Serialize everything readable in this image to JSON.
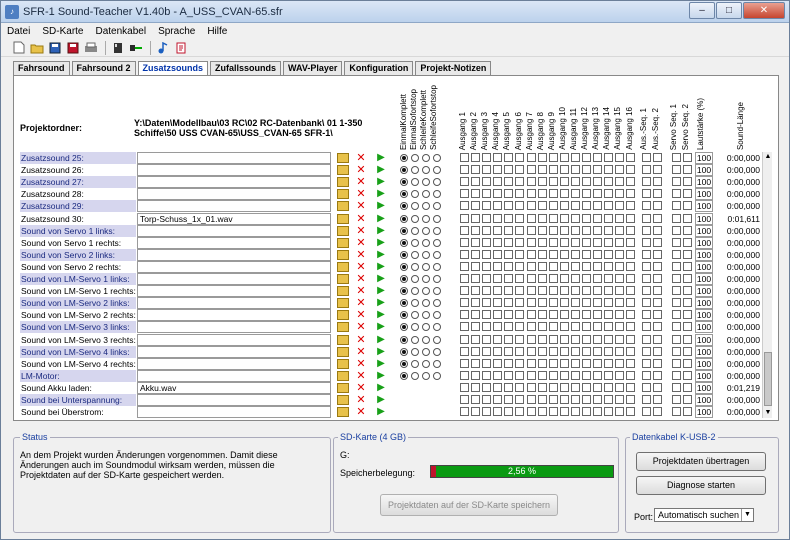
{
  "window": {
    "title": "SFR-1 Sound-Teacher V1.40b - A_USS_CVAN-65.sfr",
    "btn_min": "–",
    "btn_max": "□",
    "btn_close": "✕"
  },
  "menu": [
    "Datei",
    "SD-Karte",
    "Datenkabel",
    "Sprache",
    "Hilfe"
  ],
  "tabs": [
    "Fahrsound",
    "Fahrsound 2",
    "Zusatzsounds",
    "Zufallssounds",
    "WAV-Player",
    "Konfiguration",
    "Projekt-Notizen"
  ],
  "active_tab": 2,
  "project": {
    "label": "Projektordner:",
    "path_line1": "Y:\\Daten\\Modellbau\\03 RC\\02 RC-Datenbank\\ 01 1-350",
    "path_line2": "Schiffe\\50 USS CVAN-65\\USS_CVAN-65 SFR-1\\"
  },
  "col_headers": {
    "modes": [
      "EinmalKomplett",
      "EinmalSofortstop",
      "SchleifeKomplett",
      "SchleifeSofortstop"
    ],
    "outputs": [
      "Ausgang 1",
      "Ausgang 2",
      "Ausgang 3",
      "Ausgang 4",
      "Ausgang 5",
      "Ausgang 6",
      "Ausgang 7",
      "Ausgang 8",
      "Ausgang 9",
      "Ausgang 10",
      "Ausgang 11",
      "Ausgang 12",
      "Ausgang 13",
      "Ausgang 14",
      "Ausgang 15",
      "Ausgang 16"
    ],
    "aus_seq": [
      "Aus.-Seq. 1",
      "Aus.-Seq. 2"
    ],
    "servo_seq": [
      "Servo Seq. 1",
      "Servo Seq. 2"
    ],
    "volume": "Lautstärke (%)",
    "length": "Sound-Länge"
  },
  "rows": [
    {
      "label": "Zusatzsound 25:",
      "file": "",
      "volume": "100",
      "length": "0:00,000",
      "mode": true
    },
    {
      "label": "Zusatzsound 26:",
      "file": "",
      "volume": "100",
      "length": "0:00,000",
      "mode": true
    },
    {
      "label": "Zusatzsound 27:",
      "file": "",
      "volume": "100",
      "length": "0:00,000",
      "mode": true
    },
    {
      "label": "Zusatzsound 28:",
      "file": "",
      "volume": "100",
      "length": "0:00,000",
      "mode": true
    },
    {
      "label": "Zusatzsound 29:",
      "file": "",
      "volume": "100",
      "length": "0:00,000",
      "mode": true
    },
    {
      "label": "Zusatzsound 30:",
      "file": "Torp-Schuss_1x_01.wav",
      "volume": "100",
      "length": "0:01,611",
      "mode": true
    },
    {
      "label": "Sound von Servo 1 links:",
      "file": "",
      "volume": "100",
      "length": "0:00,000",
      "mode": true
    },
    {
      "label": "Sound von Servo 1 rechts:",
      "file": "",
      "volume": "100",
      "length": "0:00,000",
      "mode": true
    },
    {
      "label": "Sound von Servo 2 links:",
      "file": "",
      "volume": "100",
      "length": "0:00,000",
      "mode": true
    },
    {
      "label": "Sound von Servo 2 rechts:",
      "file": "",
      "volume": "100",
      "length": "0:00,000",
      "mode": true
    },
    {
      "label": "Sound von LM-Servo 1 links:",
      "file": "",
      "volume": "100",
      "length": "0:00,000",
      "mode": true
    },
    {
      "label": "Sound von LM-Servo 1 rechts:",
      "file": "",
      "volume": "100",
      "length": "0:00,000",
      "mode": true
    },
    {
      "label": "Sound von LM-Servo 2 links:",
      "file": "",
      "volume": "100",
      "length": "0:00,000",
      "mode": true
    },
    {
      "label": "Sound von LM-Servo 2 rechts:",
      "file": "",
      "volume": "100",
      "length": "0:00,000",
      "mode": true
    },
    {
      "label": "Sound von LM-Servo 3 links:",
      "file": "",
      "volume": "100",
      "length": "0:00,000",
      "mode": true
    },
    {
      "label": "Sound von LM-Servo 3 rechts:",
      "file": "",
      "volume": "100",
      "length": "0:00,000",
      "mode": true
    },
    {
      "label": "Sound von LM-Servo 4 links:",
      "file": "",
      "volume": "100",
      "length": "0:00,000",
      "mode": true
    },
    {
      "label": "Sound von LM-Servo 4 rechts:",
      "file": "",
      "volume": "100",
      "length": "0:00,000",
      "mode": true
    },
    {
      "label": "LM-Motor:",
      "file": "",
      "volume": "100",
      "length": "0:00,000",
      "mode": true
    },
    {
      "label": "Sound Akku laden:",
      "file": "Akku.wav",
      "volume": "100",
      "length": "0:01,219",
      "mode": false
    },
    {
      "label": "Sound bei Unterspannung:",
      "file": "",
      "volume": "100",
      "length": "0:00,000",
      "mode": false
    },
    {
      "label": "Sound bei Überstrom:",
      "file": "",
      "volume": "100",
      "length": "0:00,000",
      "mode": false
    }
  ],
  "status": {
    "title": "Status",
    "text": "An dem Projekt wurden Änderungen vorgenommen. Damit diese Änderungen auch im Soundmodul wirksam werden, müssen die Projektdaten auf der SD-Karte gespeichert werden."
  },
  "sd": {
    "title": "SD-Karte (4 GB)",
    "drive": "G:",
    "used_label": "Speicherbelegung:",
    "used_text": "2,56 %",
    "used_fraction": 0.0256,
    "save_button": "Projektdaten auf der SD-Karte speichern"
  },
  "cable": {
    "title": "Datenkabel K-USB-2",
    "transfer_button": "Projektdaten übertragen",
    "diag_button": "Diagnose starten",
    "port_label": "Port:",
    "port_value": "Automatisch suchen"
  }
}
